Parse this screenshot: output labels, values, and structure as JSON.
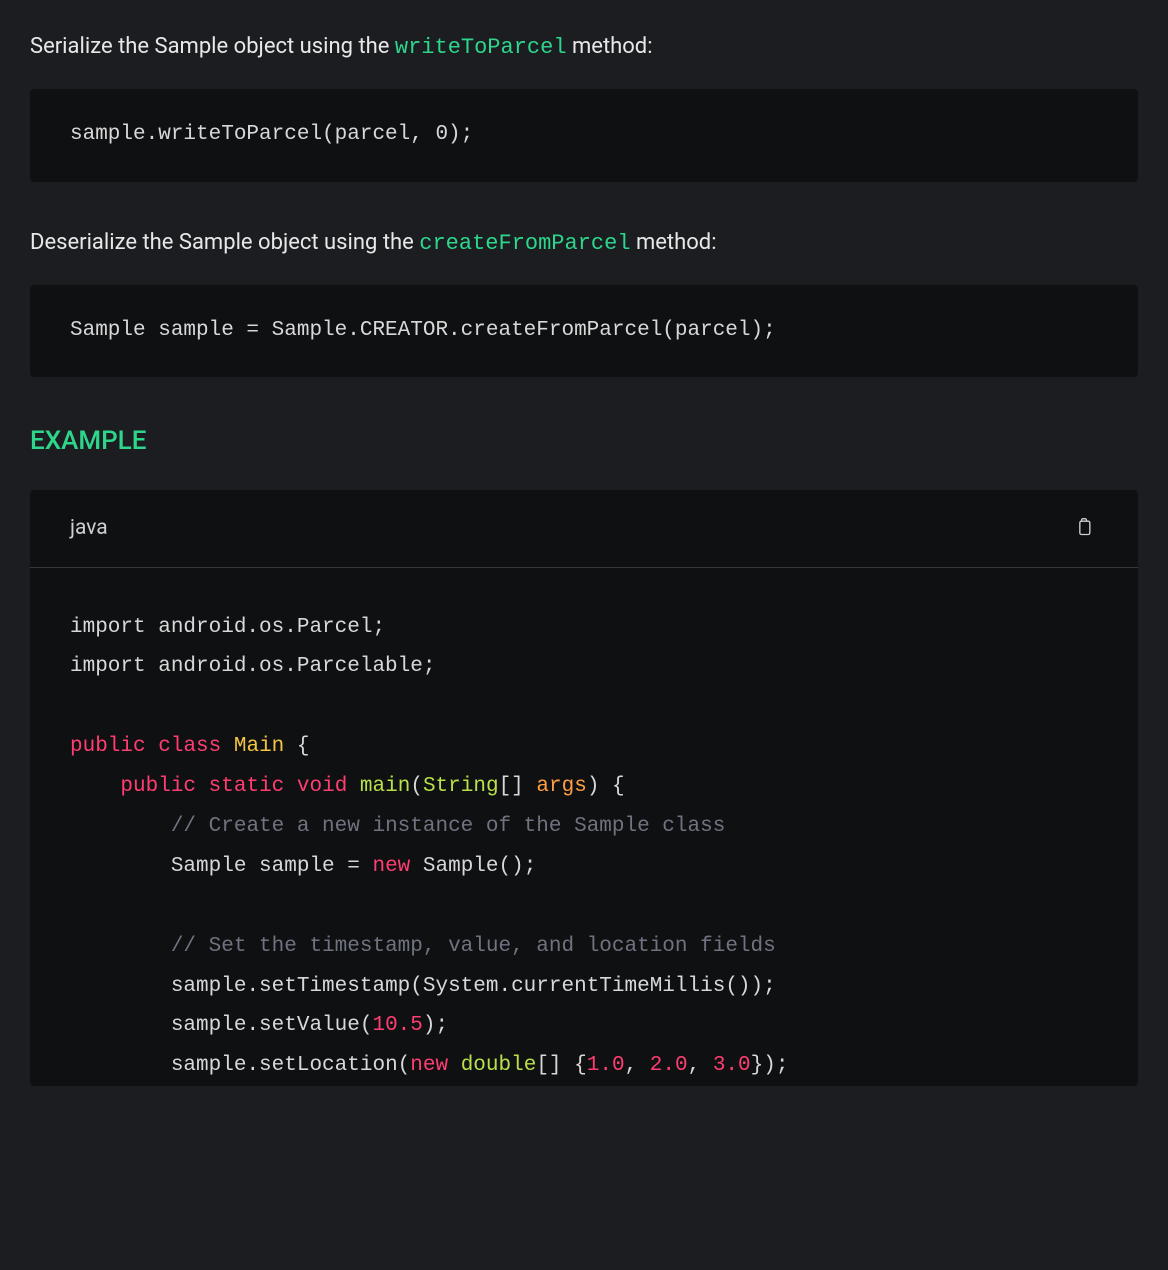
{
  "intro1": {
    "pre": "Serialize the Sample object using the ",
    "code": "writeToParcel",
    "post": " method:"
  },
  "block1": "sample.writeToParcel(parcel, 0);",
  "intro2": {
    "pre": "Deserialize the Sample object using the ",
    "code": "createFromParcel",
    "post": " method:"
  },
  "block2": "Sample sample = Sample.CREATOR.createFromParcel(parcel);",
  "heading": "EXAMPLE",
  "example": {
    "lang": "java",
    "code": {
      "import1": "import android.os.Parcel;",
      "import2": "import android.os.Parcelable;",
      "kw_public": "public",
      "kw_class": "class",
      "cls_Main": "Main",
      "brace_open": " {",
      "indent1": "    ",
      "kw_static": "static",
      "kw_void": "void",
      "fn_main": "main",
      "lp": "(",
      "type_String": "String",
      "brackets": "[] ",
      "arg_args": "args",
      "rp_brace": ") {",
      "indent2": "        ",
      "cmt1": "// Create a new instance of the Sample class",
      "line_sample_new_a": "Sample sample = ",
      "kw_new": "new",
      "line_sample_new_b": " Sample();",
      "cmt2": "// Set the timestamp, value, and location fields",
      "line_ts": "sample.setTimestamp(System.currentTimeMillis());",
      "line_val_a": "sample.setValue(",
      "num_10_5": "10.5",
      "line_val_b": ");",
      "line_loc_a": "sample.setLocation(",
      "type_double": "double",
      "line_loc_b": "[] {",
      "num_1": "1.0",
      "sep": ", ",
      "num_2": "2.0",
      "num_3": "3.0",
      "line_loc_c": "});"
    }
  }
}
